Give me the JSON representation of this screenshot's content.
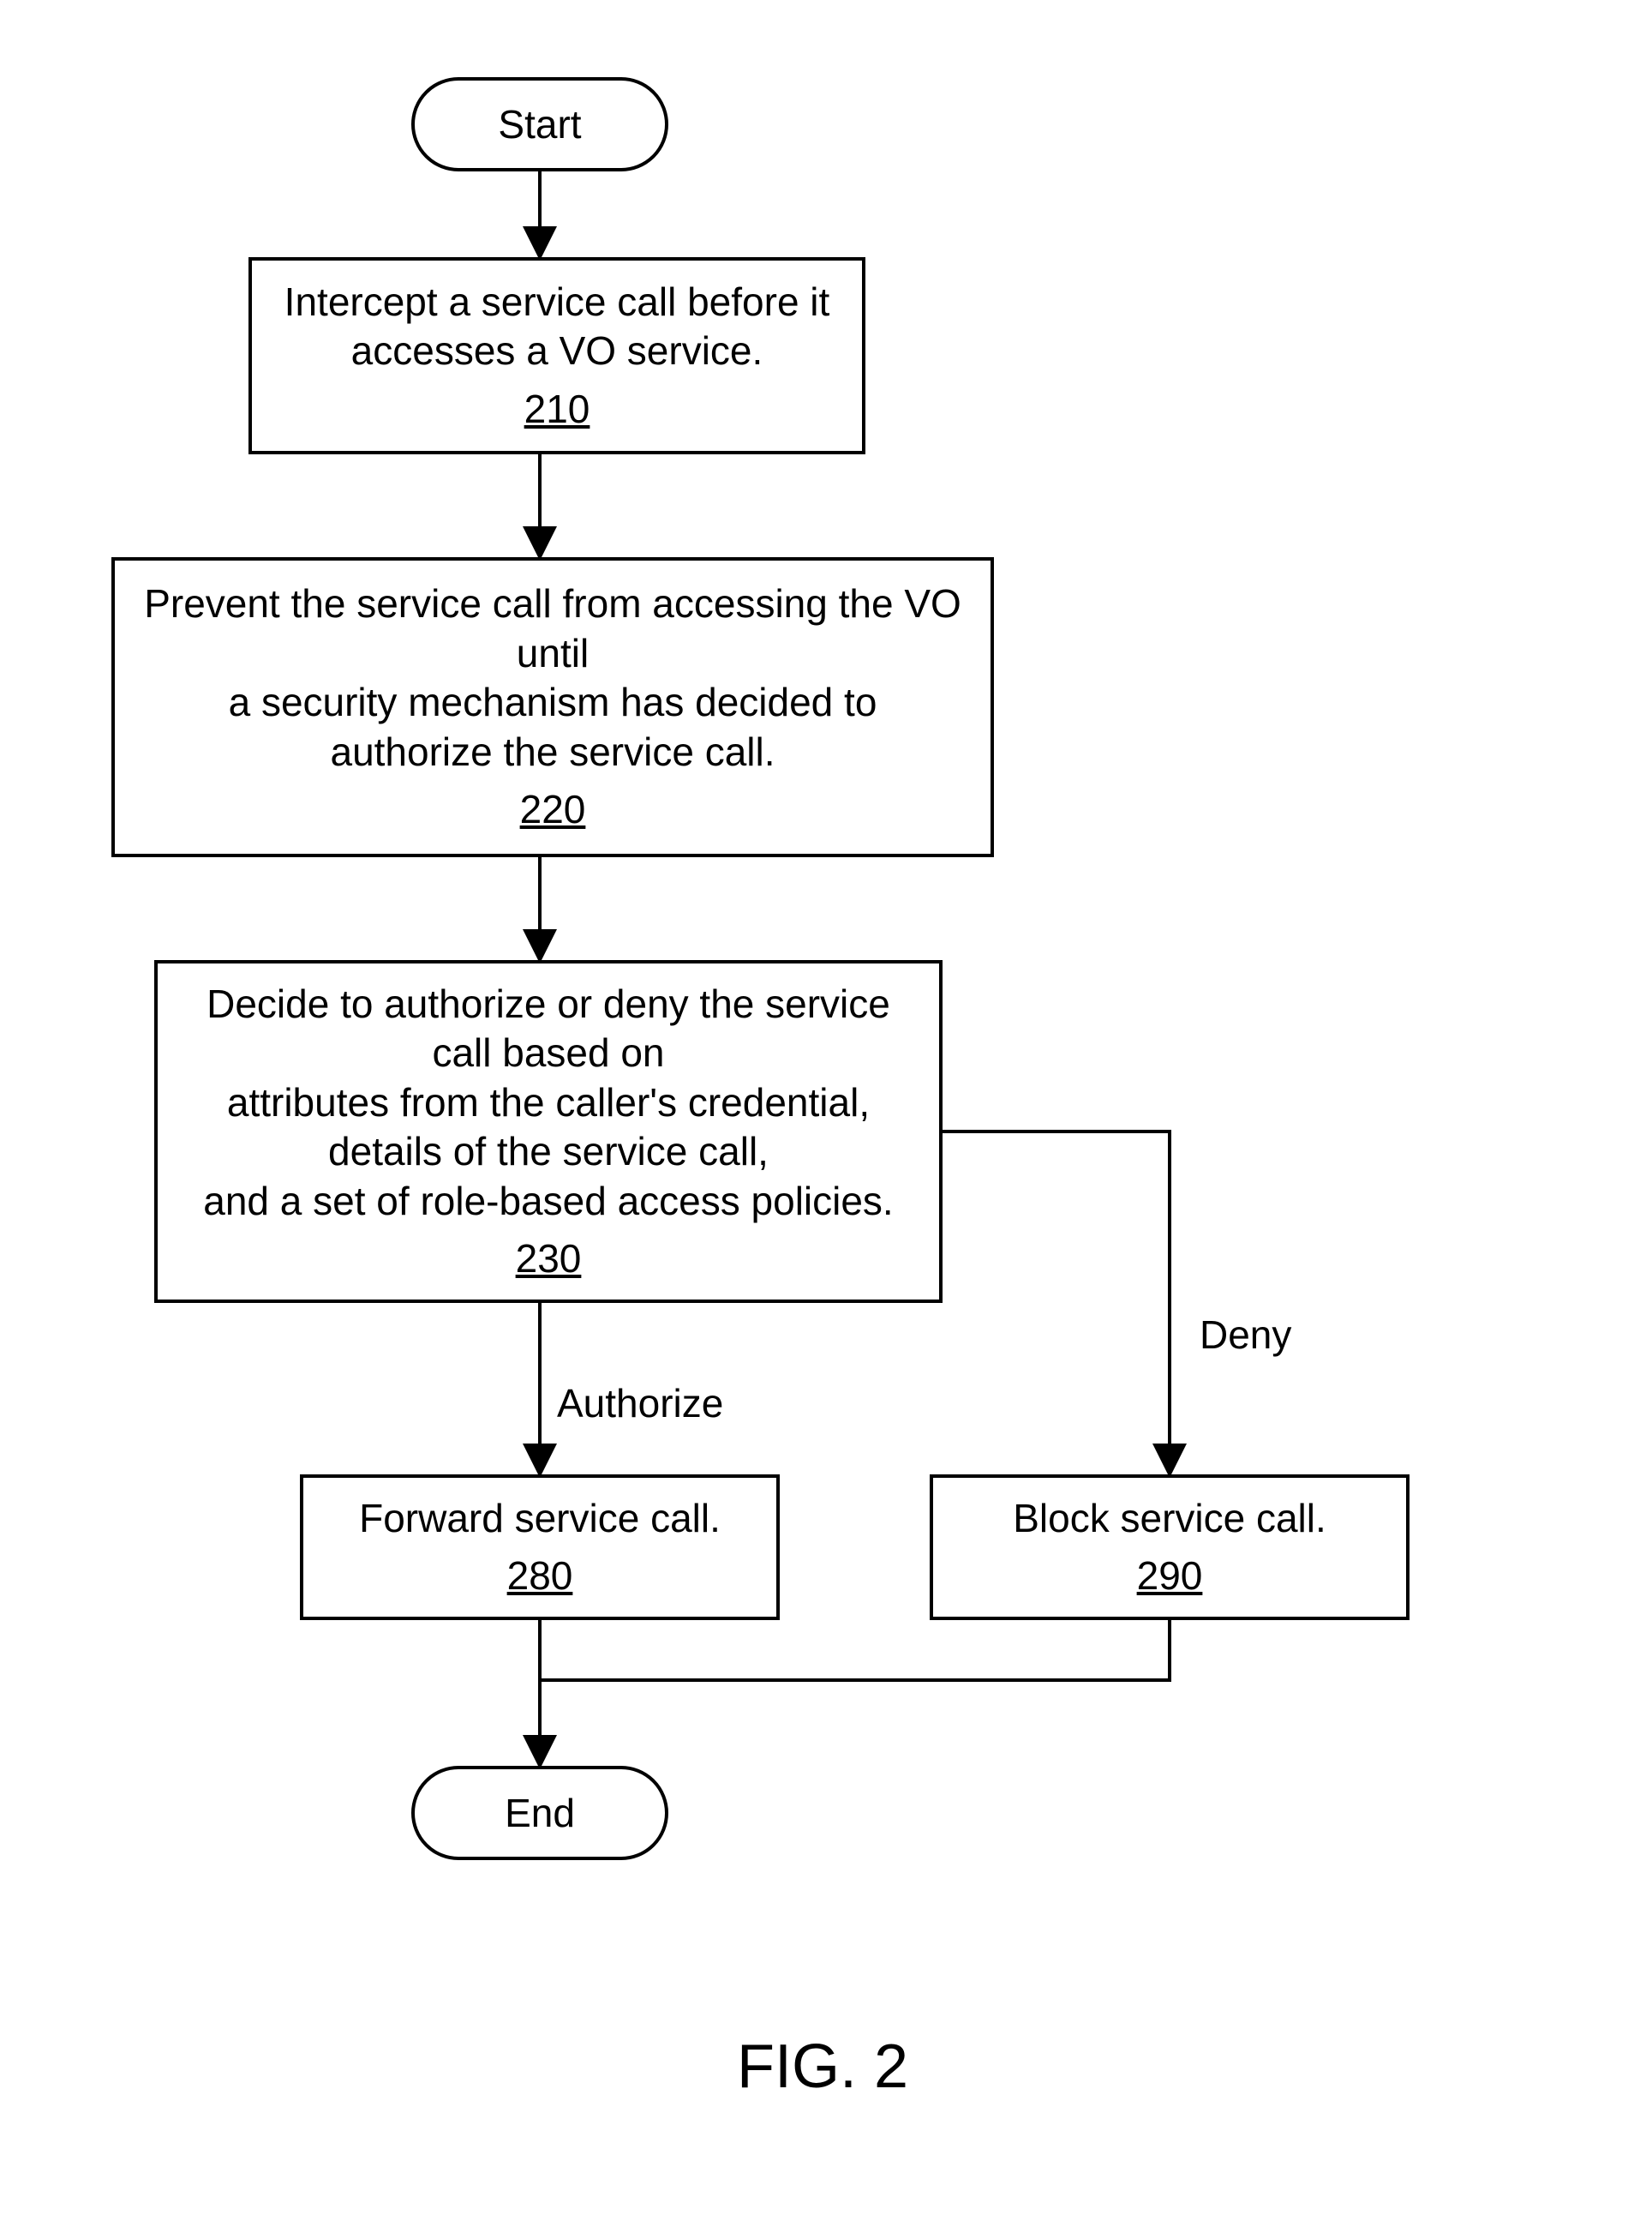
{
  "terminals": {
    "start": "Start",
    "end": "End"
  },
  "steps": {
    "s210": {
      "text": "Intercept a service call before it\naccesses a VO service.",
      "ref": "210"
    },
    "s220": {
      "text": "Prevent the service call from accessing the VO\nuntil\na security mechanism has decided to\nauthorize the service call.",
      "ref": "220"
    },
    "s230": {
      "text": "Decide to authorize or deny the service\ncall based on\nattributes from the caller's credential,\ndetails of the service call,\nand a set of role-based access policies.",
      "ref": "230"
    },
    "s280": {
      "text": "Forward service call.",
      "ref": "280"
    },
    "s290": {
      "text": "Block service call.",
      "ref": "290"
    }
  },
  "edge_labels": {
    "authorize": "Authorize",
    "deny": "Deny"
  },
  "figure_caption": "FIG. 2"
}
